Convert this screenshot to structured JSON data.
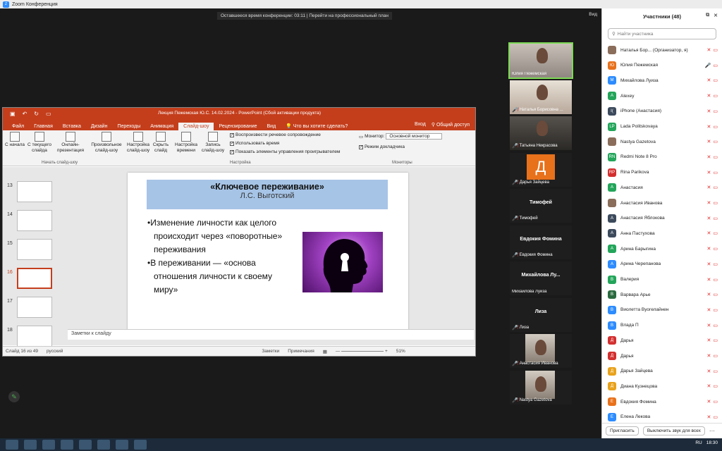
{
  "window": {
    "title": "Zoom Конференция"
  },
  "banner": "Оставшееся время конференции: 03:11 | Перейти на профессиональный план",
  "view_label": "Вид",
  "gallery": [
    {
      "name": "Юлия Пежемская",
      "kind": "video"
    },
    {
      "name": "Наталья Борисовна ...",
      "kind": "video"
    },
    {
      "name": "Татьяна Некрасова",
      "kind": "video"
    },
    {
      "name": "Дарья Зайцева",
      "kind": "avatar",
      "letter": "Д"
    },
    {
      "name": "Тимофей",
      "kind": "name",
      "big": "Тимофей"
    },
    {
      "name": "Евдокия Фомина",
      "kind": "name",
      "big": "Евдокия Фомина"
    },
    {
      "name": "Михайлова Луиза",
      "kind": "name",
      "big": "Михайлова Лу..."
    },
    {
      "name": "Лиза",
      "kind": "name",
      "big": "Лиза"
    },
    {
      "name": "Анастасия Иванова",
      "kind": "video"
    },
    {
      "name": "Nastya Gazetova",
      "kind": "video"
    }
  ],
  "ppt": {
    "title": "Лекция Пежемская Ю.С. 14.02.2024 - PowerPoint (Сбой активации продукта)",
    "tabs": [
      "Файл",
      "Главная",
      "Вставка",
      "Дизайн",
      "Переходы",
      "Анимация",
      "Слайд-шоу",
      "Рецензирование",
      "Вид"
    ],
    "tell_me": "Что вы хотите сделать?",
    "login": "Вход",
    "share": "Общий доступ",
    "ribbon": {
      "from_start": "С начала",
      "from_current": "С текущего слайда",
      "online": "Онлайн-презентация",
      "custom": "Произвольное слайд-шоу",
      "group1": "Начать слайд-шоу",
      "setup": "Настройка слайд-шоу",
      "hide": "Скрыть слайд",
      "rehearse": "Настройка времени",
      "record": "Запись слайд-шоу",
      "chk1": "Воспроизвести речевое сопровождение",
      "chk2": "Использовать время",
      "chk3": "Показать элементы управления проигрывателем",
      "group2": "Настройка",
      "monitor_label": "Монитор:",
      "monitor_value": "Основной монитор",
      "presenter": "Режим докладчика",
      "group3": "Мониторы"
    },
    "thumb_nums": [
      "13",
      "14",
      "15",
      "16",
      "17",
      "18"
    ],
    "slide": {
      "heading": "«Ключевое переживание»",
      "subheading": "Л.С. Выготский",
      "bullets": [
        "•Изменение личности как целого происходит через «поворотные» переживания",
        "•В переживании — «основа отношения личности к своему миру»"
      ]
    },
    "notes": "Заметки к слайду",
    "status": {
      "slide": "Слайд 16 из 49",
      "lang": "русский",
      "notes": "Заметки",
      "comments": "Примечания",
      "zoom": "51%"
    }
  },
  "participants": {
    "title": "Участники (48)",
    "search_placeholder": "Найти участника",
    "list": [
      {
        "name": "Наталья Бор... (Организатор, я)",
        "letter": "",
        "color": "#8a6d5a"
      },
      {
        "name": "Юлия Пежемская",
        "letter": "Ю",
        "color": "#e8711b"
      },
      {
        "name": "Михайлова Луиза",
        "letter": "М",
        "color": "#2d8cff"
      },
      {
        "name": "Alexey",
        "letter": "A",
        "color": "#23a55a"
      },
      {
        "name": "iPhone (Анастасия)",
        "letter": "I(",
        "color": "#3c4a5c"
      },
      {
        "name": "Lada Politskovaya",
        "letter": "LP",
        "color": "#23a55a"
      },
      {
        "name": "Nastya Gazetova",
        "letter": "",
        "color": "#8a6d5a"
      },
      {
        "name": "Redmi Note 8 Pro",
        "letter": "RN",
        "color": "#23a55a"
      },
      {
        "name": "Rina Parikova",
        "letter": "RP",
        "color": "#d32f2f"
      },
      {
        "name": "Анастасия",
        "letter": "А",
        "color": "#23a55a"
      },
      {
        "name": "Анастасия Иванова",
        "letter": "",
        "color": "#8a6d5a"
      },
      {
        "name": "Анастасия Яблокова",
        "letter": "А",
        "color": "#3c4a5c"
      },
      {
        "name": "Анна Пастухова",
        "letter": "А",
        "color": "#3c4a5c"
      },
      {
        "name": "Арина Барыгина",
        "letter": "А",
        "color": "#23a55a"
      },
      {
        "name": "Арина Черепанова",
        "letter": "А",
        "color": "#2d8cff"
      },
      {
        "name": "Валерия",
        "letter": "В",
        "color": "#23a55a"
      },
      {
        "name": "Варвара Арье",
        "letter": "В",
        "color": "#2b6b3f"
      },
      {
        "name": "Виолетта Вуогелайнен",
        "letter": "В",
        "color": "#2d8cff"
      },
      {
        "name": "Влада П",
        "letter": "В",
        "color": "#2d8cff"
      },
      {
        "name": "Дарья",
        "letter": "Д",
        "color": "#d32f2f"
      },
      {
        "name": "Дарья",
        "letter": "Д",
        "color": "#d32f2f"
      },
      {
        "name": "Дарья Зайцева",
        "letter": "Д",
        "color": "#e8a21b"
      },
      {
        "name": "Диана Кузнецова",
        "letter": "Д",
        "color": "#e8a21b"
      },
      {
        "name": "Евдокия Фомина",
        "letter": "Е",
        "color": "#e8711b"
      },
      {
        "name": "Елена Лекова",
        "letter": "Е",
        "color": "#2d8cff"
      }
    ],
    "invite": "Пригласить",
    "mute_all": "Выключить звук для всех"
  },
  "taskbar": {
    "lang": "RU",
    "time": "18:30"
  }
}
